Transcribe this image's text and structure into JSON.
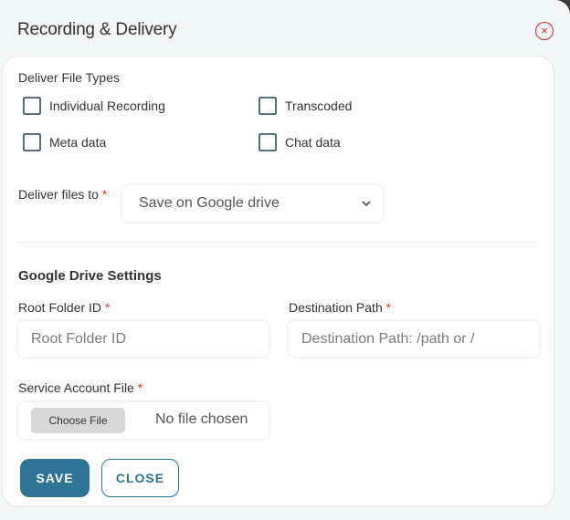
{
  "modal": {
    "title": "Recording & Delivery",
    "close_icon": "close-circle-icon",
    "close_glyph": "×"
  },
  "file_types": {
    "label": "Deliver File Types",
    "options": [
      {
        "label": "Individual Recording",
        "checked": false
      },
      {
        "label": "Transcoded",
        "checked": false
      },
      {
        "label": "Meta data",
        "checked": false
      },
      {
        "label": "Chat data",
        "checked": false
      }
    ]
  },
  "deliver_to": {
    "label": "Deliver files to",
    "required_mark": "*",
    "selected": "Save on Google drive",
    "chevron": "⌄"
  },
  "google_drive": {
    "title": "Google Drive Settings",
    "root_folder": {
      "label": "Root Folder ID",
      "required_mark": "*",
      "value": "",
      "placeholder": "Root Folder ID"
    },
    "destination_path": {
      "label": "Destination Path",
      "required_mark": "*",
      "value": "",
      "placeholder": "Destination Path: /path or /"
    },
    "service_account": {
      "label": "Service Account File",
      "required_mark": "*",
      "button": "Choose File",
      "status": "No file chosen"
    }
  },
  "actions": {
    "save": "SAVE",
    "close": "CLOSE"
  },
  "colors": {
    "primary": "#2e7497",
    "danger": "#e0212b",
    "background": "#f2f7f7"
  }
}
